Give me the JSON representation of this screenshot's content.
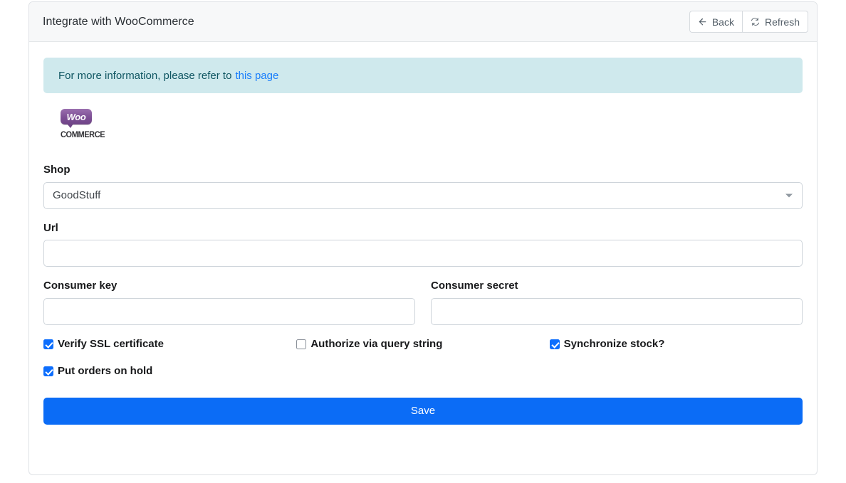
{
  "header": {
    "title": "Integrate with WooCommerce",
    "back_label": "Back",
    "refresh_label": "Refresh"
  },
  "alert": {
    "text": "For more information, please refer to",
    "link_label": "this page"
  },
  "logo": {
    "bubble_text": "Woo",
    "word_text": "COMMERCE",
    "brand_color": "#7d4f95"
  },
  "form": {
    "shop": {
      "label": "Shop",
      "value": "GoodStuff",
      "options": [
        "GoodStuff"
      ]
    },
    "url": {
      "label": "Url",
      "value": "",
      "placeholder": ""
    },
    "consumer_key": {
      "label": "Consumer key",
      "value": "",
      "placeholder": ""
    },
    "consumer_secret": {
      "label": "Consumer secret",
      "value": "",
      "placeholder": ""
    },
    "checkboxes": [
      {
        "label": "Verify SSL certificate",
        "checked": true
      },
      {
        "label": "Authorize via query string",
        "checked": false
      },
      {
        "label": "Synchronize stock?",
        "checked": true
      },
      {
        "label": "Put orders on hold",
        "checked": true
      }
    ],
    "save_label": "Save"
  },
  "colors": {
    "primary": "#0b6cf6",
    "info_bg": "#cfe9ed",
    "info_text": "#0f5662",
    "link": "#1a7efb"
  }
}
